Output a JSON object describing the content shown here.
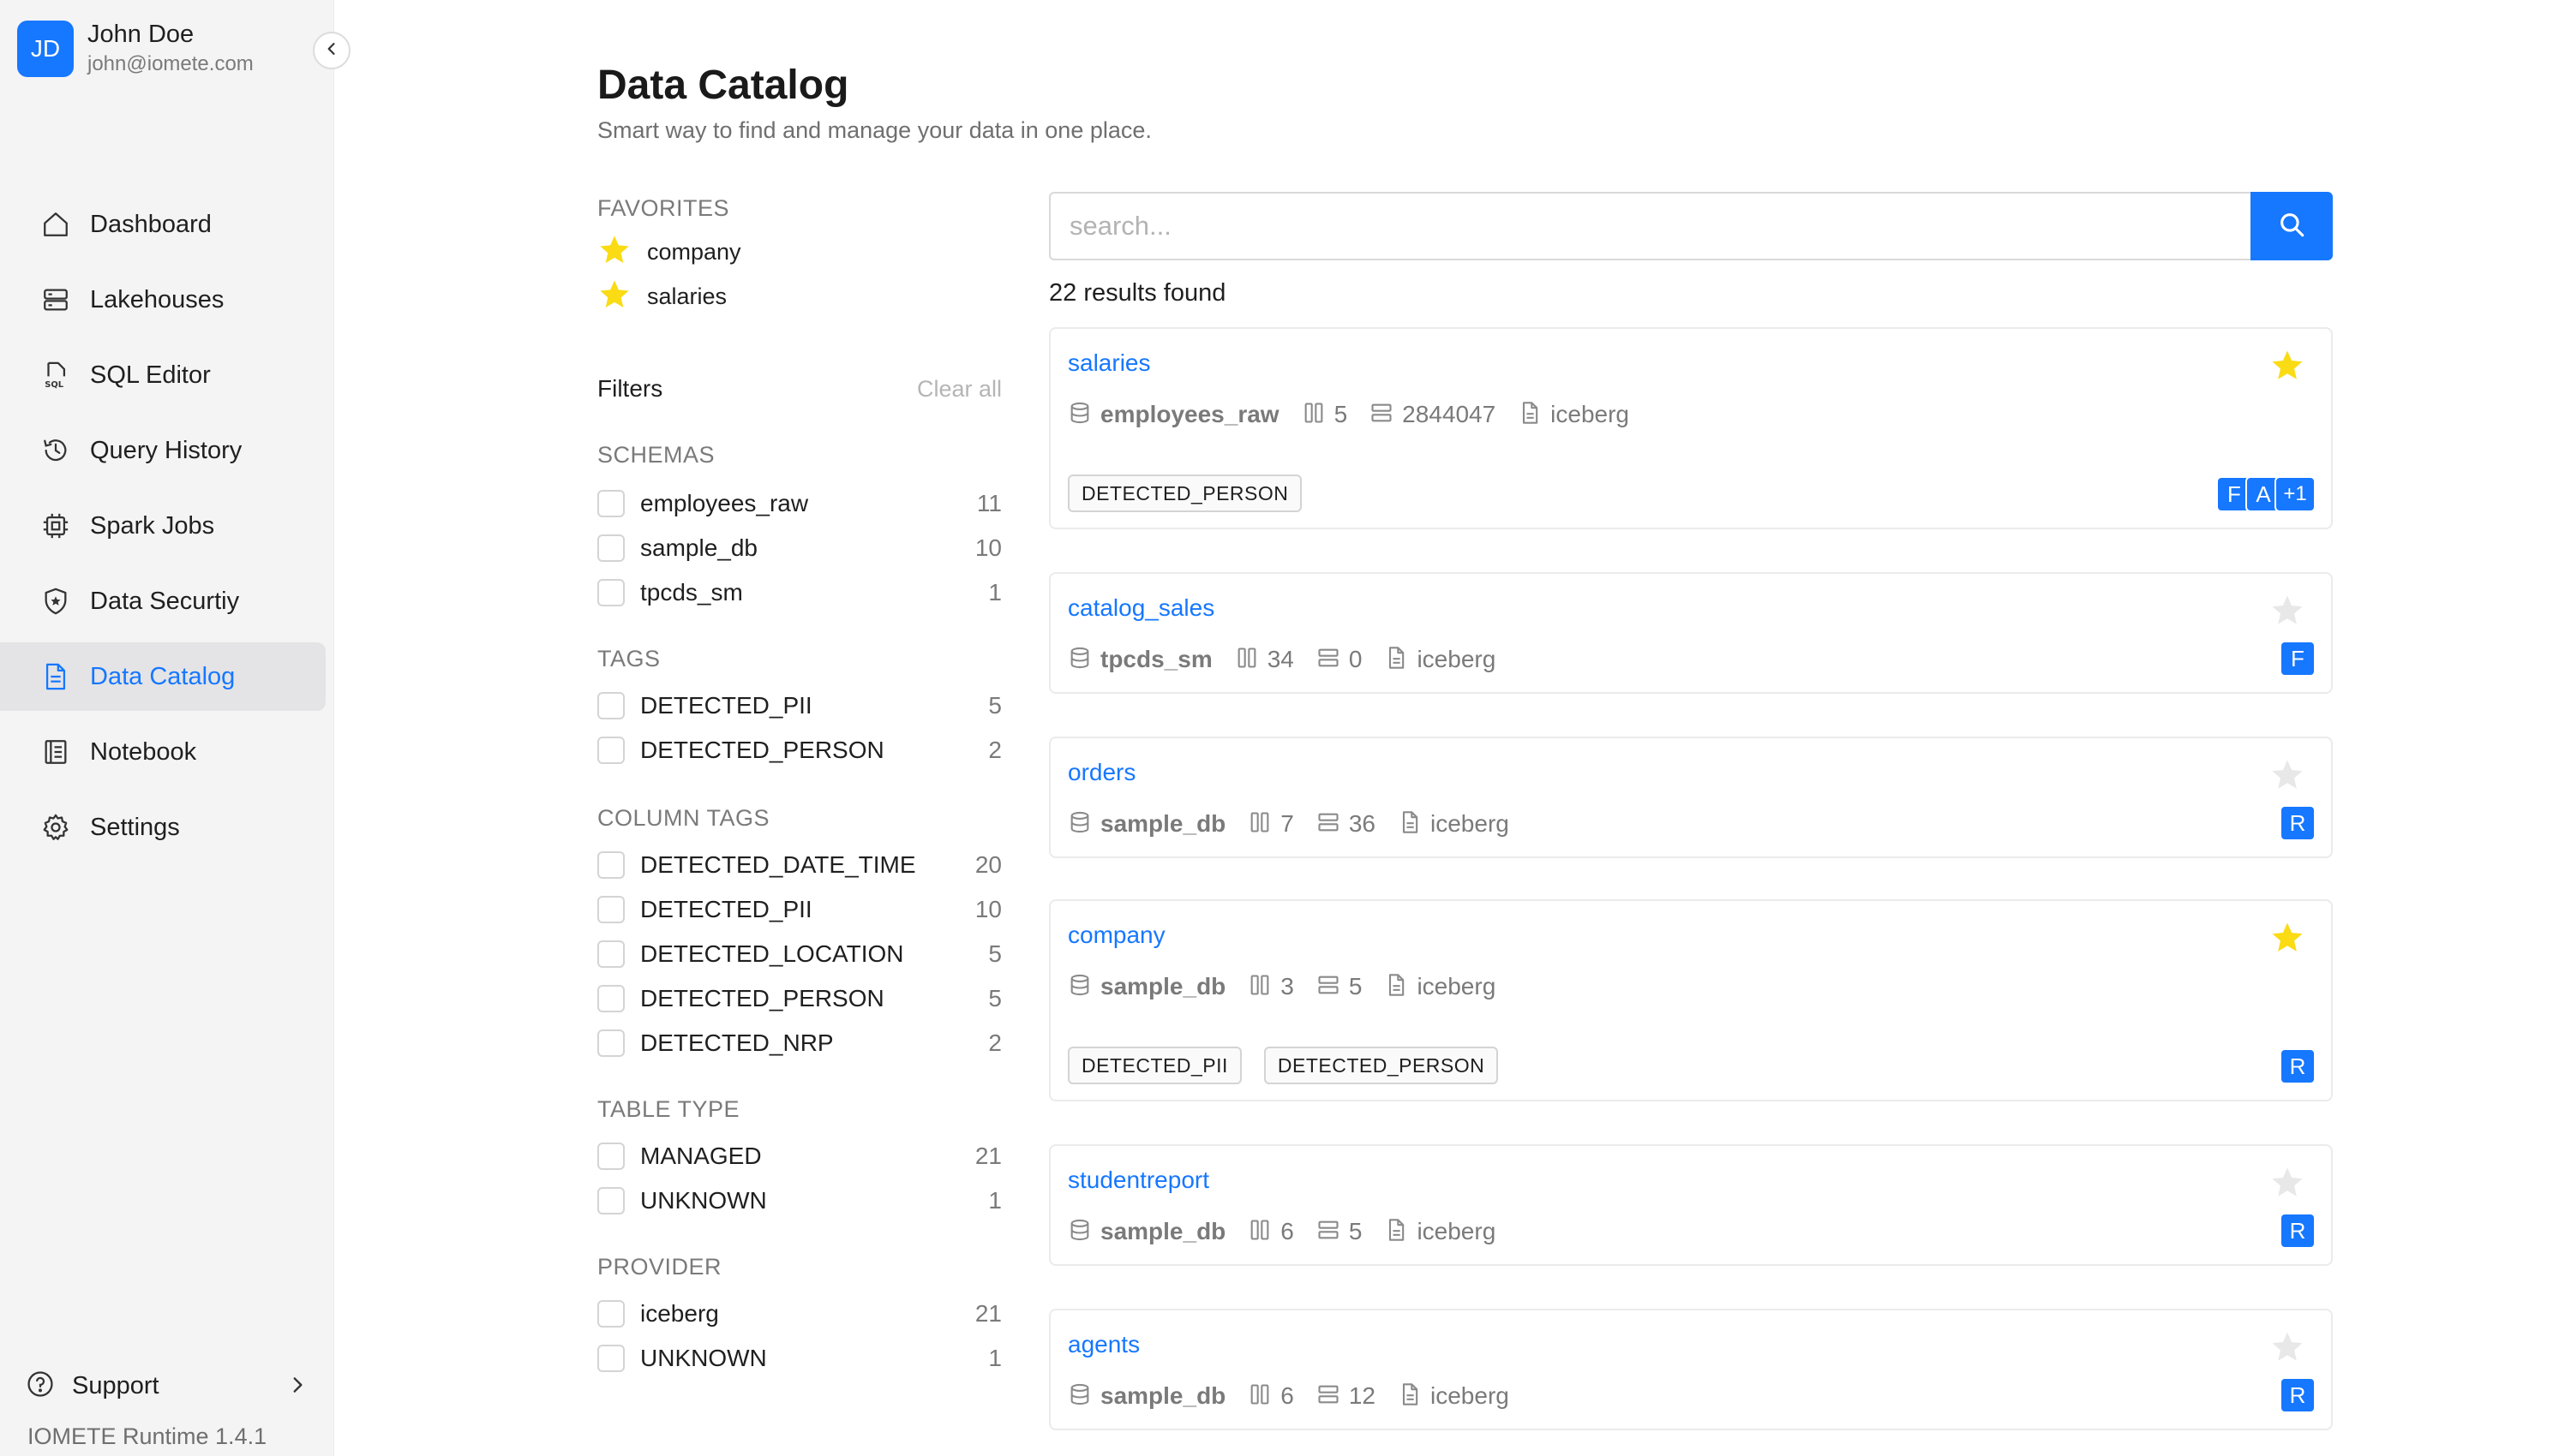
{
  "user": {
    "initials": "JD",
    "name": "John Doe",
    "email": "john@iomete.com"
  },
  "nav": [
    {
      "label": "Dashboard",
      "icon": "home-icon",
      "active": false
    },
    {
      "label": "Lakehouses",
      "icon": "server-icon",
      "active": false
    },
    {
      "label": "SQL Editor",
      "icon": "sql-file-icon",
      "active": false
    },
    {
      "label": "Query History",
      "icon": "history-icon",
      "active": false
    },
    {
      "label": "Spark Jobs",
      "icon": "chip-icon",
      "active": false
    },
    {
      "label": "Data Securtiy",
      "icon": "shield-icon",
      "active": false
    },
    {
      "label": "Data Catalog",
      "icon": "catalog-file-icon",
      "active": true
    },
    {
      "label": "Notebook",
      "icon": "notebook-icon",
      "active": false
    },
    {
      "label": "Settings",
      "icon": "gear-icon",
      "active": false
    }
  ],
  "support": {
    "label": "Support"
  },
  "runtime": "IOMETE Runtime 1.4.1",
  "header": {
    "title": "Data Catalog",
    "subtitle": "Smart way to find and manage your data in one place."
  },
  "favorites": {
    "title": "FAVORITES",
    "items": [
      "company",
      "salaries"
    ]
  },
  "filters": {
    "title": "Filters",
    "clear_all": "Clear all",
    "groups": [
      {
        "title": "SCHEMAS",
        "items": [
          {
            "label": "employees_raw",
            "count": "11"
          },
          {
            "label": "sample_db",
            "count": "10"
          },
          {
            "label": "tpcds_sm",
            "count": "1"
          }
        ]
      },
      {
        "title": "TAGS",
        "items": [
          {
            "label": "DETECTED_PII",
            "count": "5"
          },
          {
            "label": "DETECTED_PERSON",
            "count": "2"
          }
        ]
      },
      {
        "title": "COLUMN TAGS",
        "items": [
          {
            "label": "DETECTED_DATE_TIME",
            "count": "20"
          },
          {
            "label": "DETECTED_PII",
            "count": "10"
          },
          {
            "label": "DETECTED_LOCATION",
            "count": "5"
          },
          {
            "label": "DETECTED_PERSON",
            "count": "5"
          },
          {
            "label": "DETECTED_NRP",
            "count": "2"
          }
        ]
      },
      {
        "title": "TABLE TYPE",
        "items": [
          {
            "label": "MANAGED",
            "count": "21"
          },
          {
            "label": "UNKNOWN",
            "count": "1"
          }
        ]
      },
      {
        "title": "PROVIDER",
        "items": [
          {
            "label": "iceberg",
            "count": "21"
          },
          {
            "label": "UNKNOWN",
            "count": "1"
          }
        ]
      }
    ]
  },
  "search": {
    "placeholder": "search..."
  },
  "results": {
    "count_text": "22 results found",
    "items": [
      {
        "name": "salaries",
        "favorite": true,
        "schema": "employees_raw",
        "columns": "5",
        "rows": "2844047",
        "provider": "iceberg",
        "tags": [
          "DETECTED_PERSON"
        ],
        "owners": [
          "F",
          "A",
          "+1"
        ]
      },
      {
        "name": "catalog_sales",
        "favorite": false,
        "schema": "tpcds_sm",
        "columns": "34",
        "rows": "0",
        "provider": "iceberg",
        "tags": [],
        "owners": [
          "F"
        ]
      },
      {
        "name": "orders",
        "favorite": false,
        "schema": "sample_db",
        "columns": "7",
        "rows": "36",
        "provider": "iceberg",
        "tags": [],
        "owners": [
          "R"
        ]
      },
      {
        "name": "company",
        "favorite": true,
        "schema": "sample_db",
        "columns": "3",
        "rows": "5",
        "provider": "iceberg",
        "tags": [
          "DETECTED_PII",
          "DETECTED_PERSON"
        ],
        "owners": [
          "R"
        ]
      },
      {
        "name": "studentreport",
        "favorite": false,
        "schema": "sample_db",
        "columns": "6",
        "rows": "5",
        "provider": "iceberg",
        "tags": [],
        "owners": [
          "R"
        ]
      },
      {
        "name": "agents",
        "favorite": false,
        "schema": "sample_db",
        "columns": "6",
        "rows": "12",
        "provider": "iceberg",
        "tags": [],
        "owners": [
          "R"
        ]
      }
    ]
  },
  "colors": {
    "accent": "#1677ff",
    "star_on": "#fadb14",
    "star_off": "#e8e8e8",
    "sidebar_bg": "#f4f4f5"
  }
}
